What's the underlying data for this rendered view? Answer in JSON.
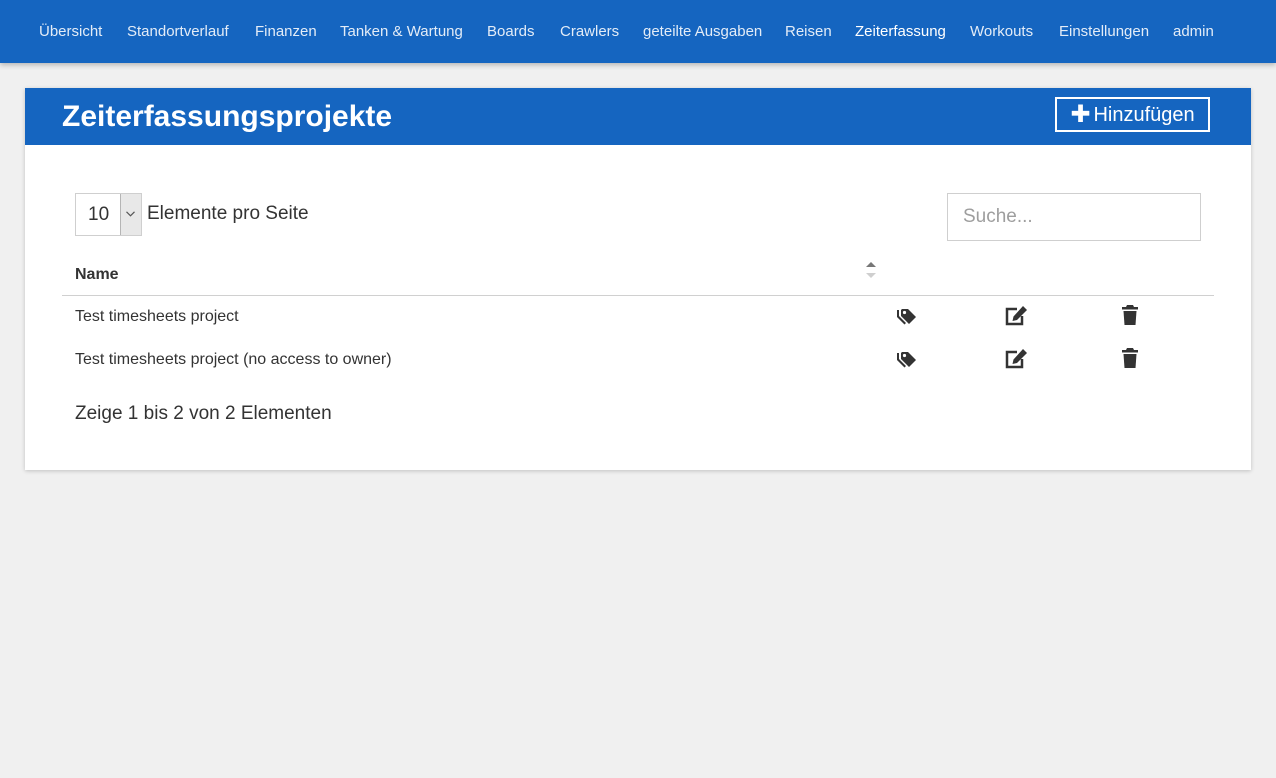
{
  "nav": {
    "items": [
      {
        "label": "Übersicht"
      },
      {
        "label": "Standortverlauf"
      },
      {
        "label": "Finanzen"
      },
      {
        "label": "Tanken & Wartung"
      },
      {
        "label": "Boards"
      },
      {
        "label": "Crawlers"
      },
      {
        "label": "geteilte Ausgaben"
      },
      {
        "label": "Reisen"
      },
      {
        "label": "Zeiterfassung",
        "active": true
      },
      {
        "label": "Workouts"
      },
      {
        "label": "Einstellungen"
      },
      {
        "label": "admin"
      }
    ]
  },
  "card": {
    "title": "Zeiterfassungsprojekte",
    "add_label": "Hinzufügen"
  },
  "controls": {
    "page_size": "10",
    "page_size_label": "Elemente pro Seite",
    "search_placeholder": "Suche..."
  },
  "table": {
    "columns": [
      "Name"
    ],
    "rows": [
      {
        "name": "Test timesheets project",
        "icons": [
          "tags-icon",
          "edit-icon",
          "trash-icon"
        ]
      },
      {
        "name": "Test timesheets project (no access to owner)",
        "icons": [
          "tags-icon",
          "edit-icon",
          "trash-icon"
        ]
      }
    ],
    "summary": "Zeige 1 bis 2 von 2 Elementen"
  },
  "colors": {
    "primary": "#1565c0",
    "background": "#f0f0f0",
    "card": "#ffffff",
    "icon": "#333333"
  }
}
